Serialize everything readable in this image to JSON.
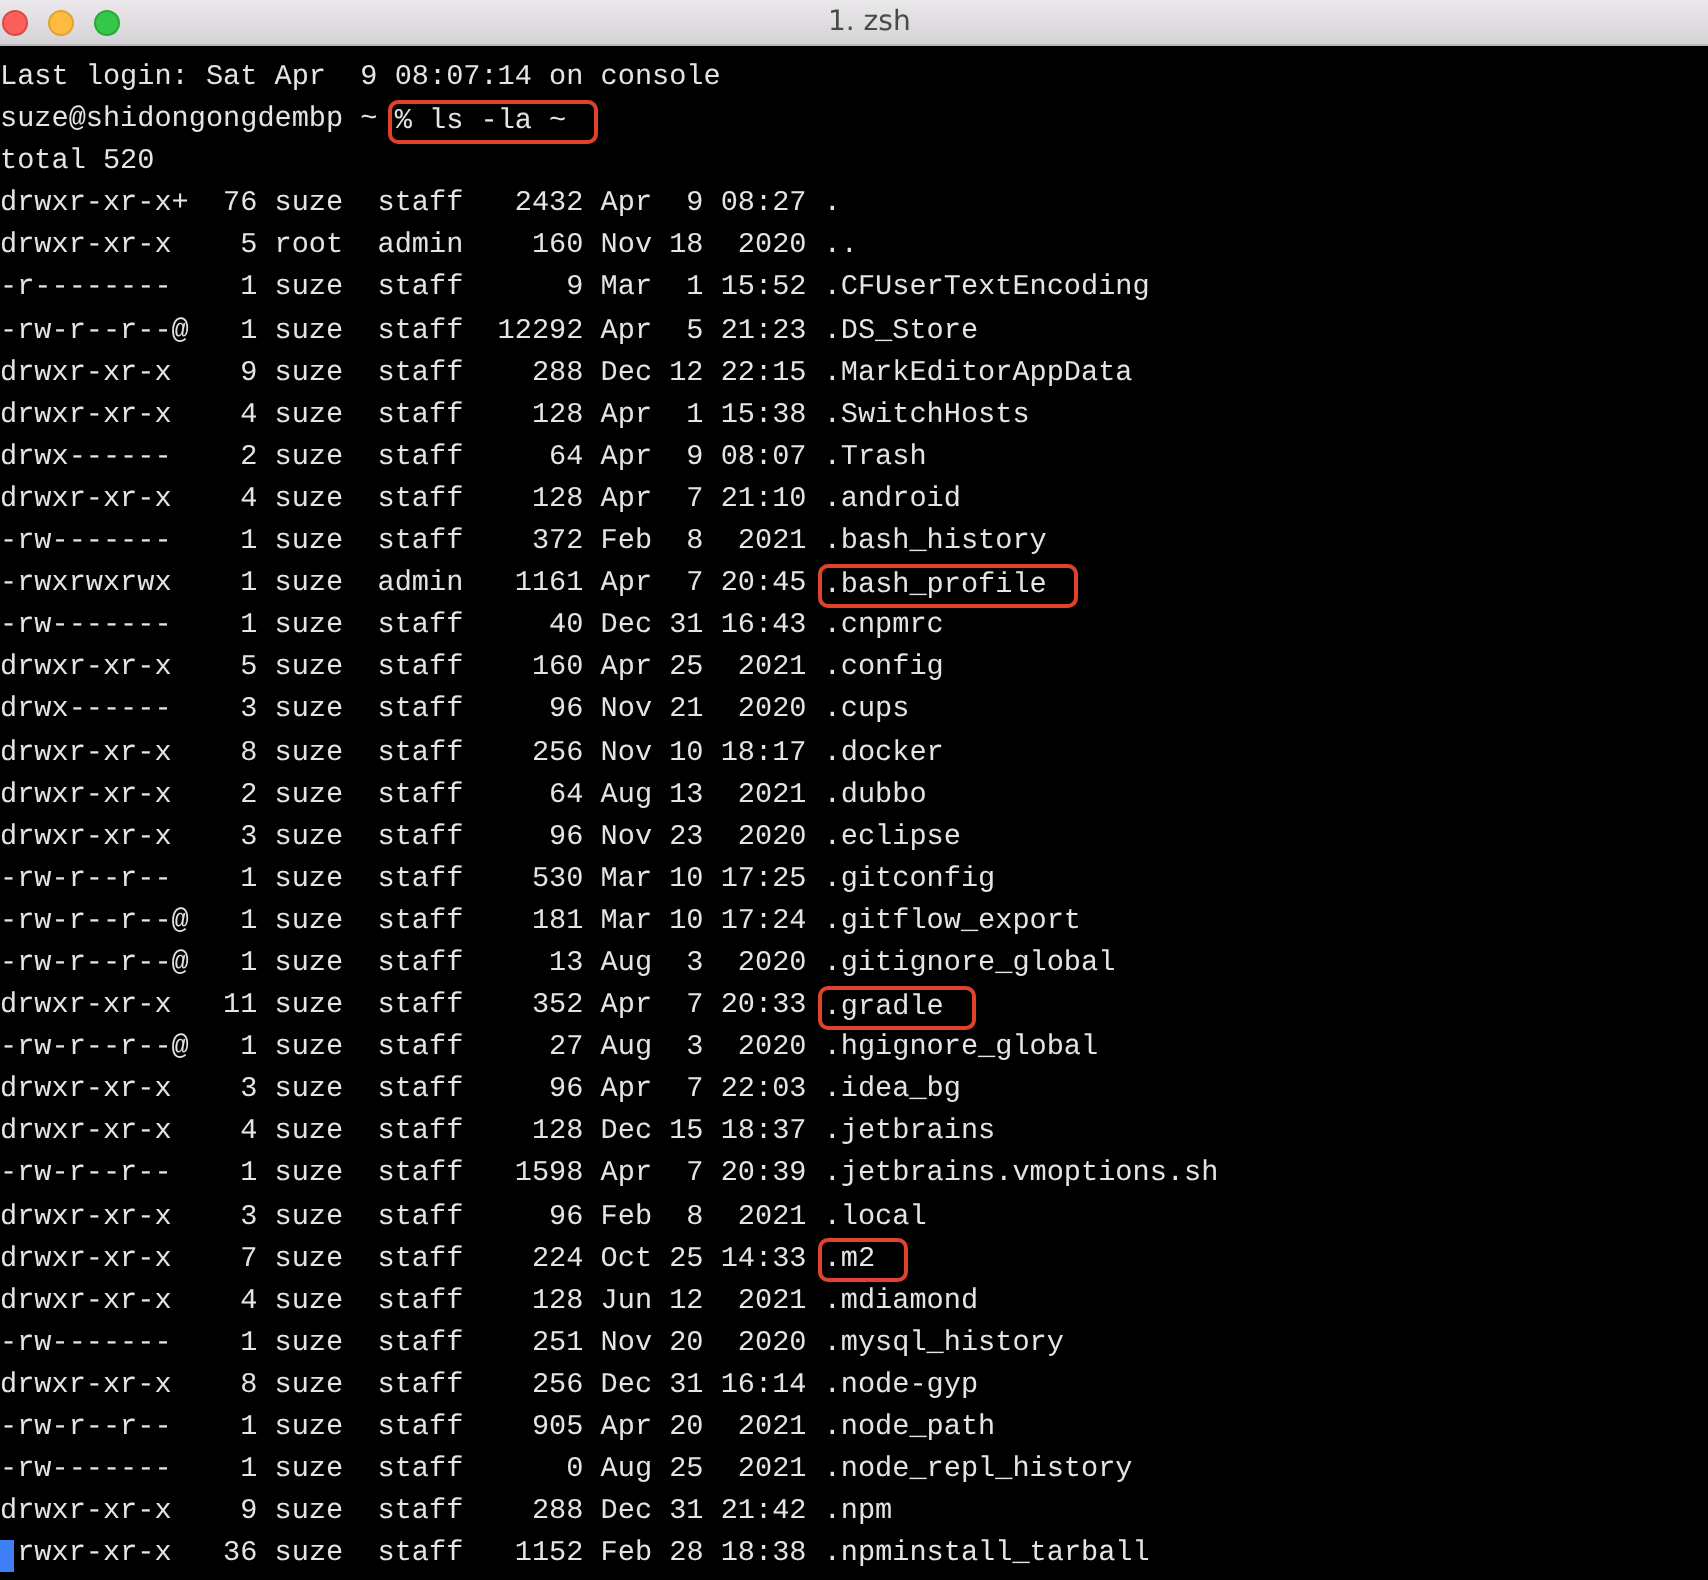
{
  "window": {
    "title": "1. zsh"
  },
  "lines": [
    {
      "text": "Last login: Sat Apr  9 08:07:14 on console"
    },
    {
      "text": "suze@shidongongdembp ~ ",
      "note": "% ls -la ~"
    },
    {
      "text": "total 520"
    },
    {
      "text": "drwxr-xr-x+  76 suze  staff   2432 Apr  9 08:27 ."
    },
    {
      "text": "drwxr-xr-x    5 root  admin    160 Nov 18  2020 .."
    },
    {
      "text": "-r--------    1 suze  staff      9 Mar  1 15:52 .CFUserTextEncoding"
    },
    {
      "text": "-rw-r--r--@   1 suze  staff  12292 Apr  5 21:23 .DS_Store"
    },
    {
      "text": "drwxr-xr-x    9 suze  staff    288 Dec 12 22:15 .MarkEditorAppData"
    },
    {
      "text": "drwxr-xr-x    4 suze  staff    128 Apr  1 15:38 .SwitchHosts"
    },
    {
      "text": "drwx------    2 suze  staff     64 Apr  9 08:07 .Trash"
    },
    {
      "text": "drwxr-xr-x    4 suze  staff    128 Apr  7 21:10 .android"
    },
    {
      "text": "-rw-------    1 suze  staff    372 Feb  8  2021 .bash_history"
    },
    {
      "text": "-rwxrwxrwx    1 suze  admin   1161 Apr  7 20:45 ",
      "note": ".bash_profile"
    },
    {
      "text": "-rw-------    1 suze  staff     40 Dec 31 16:43 .cnpmrc"
    },
    {
      "text": "drwxr-xr-x    5 suze  staff    160 Apr 25  2021 .config"
    },
    {
      "text": "drwx------    3 suze  staff     96 Nov 21  2020 .cups"
    },
    {
      "text": "drwxr-xr-x    8 suze  staff    256 Nov 10 18:17 .docker"
    },
    {
      "text": "drwxr-xr-x    2 suze  staff     64 Aug 13  2021 .dubbo"
    },
    {
      "text": "drwxr-xr-x    3 suze  staff     96 Nov 23  2020 .eclipse"
    },
    {
      "text": "-rw-r--r--    1 suze  staff    530 Mar 10 17:25 .gitconfig"
    },
    {
      "text": "-rw-r--r--@   1 suze  staff    181 Mar 10 17:24 .gitflow_export"
    },
    {
      "text": "-rw-r--r--@   1 suze  staff     13 Aug  3  2020 .gitignore_global"
    },
    {
      "text": "drwxr-xr-x   11 suze  staff    352 Apr  7 20:33 ",
      "note": ".gradle"
    },
    {
      "text": "-rw-r--r--@   1 suze  staff     27 Aug  3  2020 .hgignore_global"
    },
    {
      "text": "drwxr-xr-x    3 suze  staff     96 Apr  7 22:03 .idea_bg"
    },
    {
      "text": "drwxr-xr-x    4 suze  staff    128 Dec 15 18:37 .jetbrains"
    },
    {
      "text": "-rw-r--r--    1 suze  staff   1598 Apr  7 20:39 .jetbrains.vmoptions.sh"
    },
    {
      "text": "drwxr-xr-x    3 suze  staff     96 Feb  8  2021 .local"
    },
    {
      "text": "drwxr-xr-x    7 suze  staff    224 Oct 25 14:33 ",
      "note": ".m2"
    },
    {
      "text": "drwxr-xr-x    4 suze  staff    128 Jun 12  2021 .mdiamond"
    },
    {
      "text": "-rw-------    1 suze  staff    251 Nov 20  2020 .mysql_history"
    },
    {
      "text": "drwxr-xr-x    8 suze  staff    256 Dec 31 16:14 .node-gyp"
    },
    {
      "text": "-rw-r--r--    1 suze  staff    905 Apr 20  2021 .node_path"
    },
    {
      "text": "-rw-------    1 suze  staff      0 Aug 25  2021 .node_repl_history"
    },
    {
      "text": "drwxr-xr-x    9 suze  staff    288 Dec 31 21:42 .npm"
    },
    {
      "text": "rwxr-xr-x   36 suze  staff   1152 Feb 28 18:38 .npminstall_tarball",
      "cursor": true
    }
  ]
}
